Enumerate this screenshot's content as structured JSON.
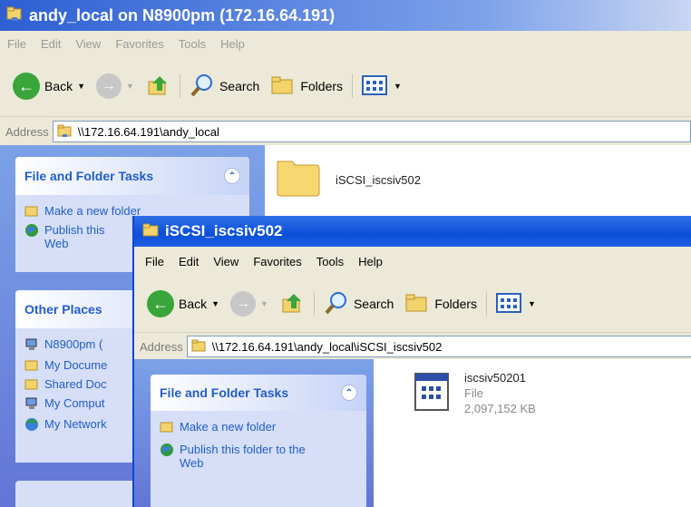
{
  "back_window": {
    "title": "andy_local on N8900pm (172.16.64.191)",
    "menu": [
      "File",
      "Edit",
      "View",
      "Favorites",
      "Tools",
      "Help"
    ],
    "toolbar": {
      "back": "Back",
      "search": "Search",
      "folders": "Folders"
    },
    "address_label": "Address",
    "address": "\\\\172.16.64.191\\andy_local",
    "tasks": {
      "title": "File and Folder Tasks",
      "items": [
        "Make a new folder",
        "Publish this",
        "Web"
      ]
    },
    "other_places": {
      "title": "Other Places",
      "items": [
        "N8900pm (",
        "My Docume",
        "Shared Doc",
        "My Comput",
        "My Network"
      ]
    },
    "folder_item": {
      "name": "iSCSI_iscsiv502"
    }
  },
  "front_window": {
    "title": "iSCSI_iscsiv502",
    "menu": [
      "File",
      "Edit",
      "View",
      "Favorites",
      "Tools",
      "Help"
    ],
    "toolbar": {
      "back": "Back",
      "search": "Search",
      "folders": "Folders"
    },
    "address_label": "Address",
    "address": "\\\\172.16.64.191\\andy_local\\iSCSI_iscsiv502",
    "tasks": {
      "title": "File and Folder Tasks",
      "items": [
        "Make a new folder",
        "Publish this folder to the",
        "Web"
      ]
    },
    "file_item": {
      "name": "iscsiv50201",
      "type": "File",
      "size": "2,097,152 KB"
    }
  }
}
